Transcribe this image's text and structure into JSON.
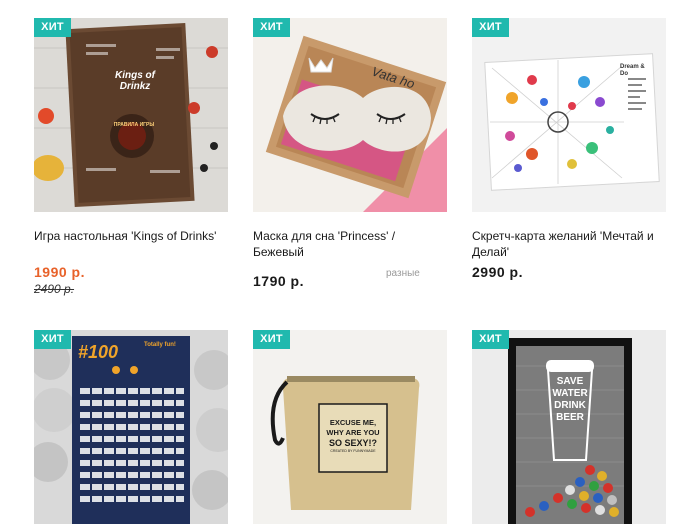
{
  "accent": "#20b9ae",
  "sale_color": "#e8622a",
  "products": [
    {
      "badge": "ХИТ",
      "title": "Игра настольная 'Kings of Drinks'",
      "price": "1990 р.",
      "old_price": "2490 р.",
      "image_text": "Kings of Drinkz",
      "image_subtext": "ПРАВИЛА ИГРЫ"
    },
    {
      "badge": "ХИТ",
      "title": "Маска для сна 'Princess' / Бежевый",
      "price": "1790 р.",
      "variant": "разные",
      "image_text": "Vata ho"
    },
    {
      "badge": "ХИТ",
      "title": "Скретч-карта желаний 'Мечтай и Делай'",
      "price": "2990 р.",
      "image_text": "Dream & Do"
    },
    {
      "badge": "ХИТ",
      "image_text": "#100",
      "image_subtext": "Totally fun!"
    },
    {
      "badge": "ХИТ",
      "image_text_lines": [
        "EXCUSE ME,",
        "WHY ARE YOU",
        "SO SEXY!?"
      ],
      "image_subtext": "CREATED BY FUNNYMADE"
    },
    {
      "badge": "ХИТ",
      "image_text_lines": [
        "SAVE",
        "WATER",
        "DRINK",
        "BEER"
      ]
    }
  ]
}
